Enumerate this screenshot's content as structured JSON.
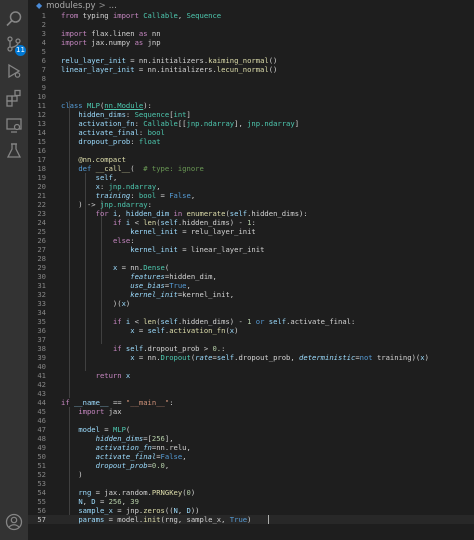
{
  "breadcrumb": {
    "file": "modules.py",
    "separator": ">",
    "tail": "..."
  },
  "activity_bar": {
    "icons": [
      {
        "name": "search-icon"
      },
      {
        "name": "source-control-icon",
        "badge": "11"
      },
      {
        "name": "run-debug-icon"
      },
      {
        "name": "extensions-icon"
      },
      {
        "name": "remote-explorer-icon"
      },
      {
        "name": "testing-icon"
      },
      {
        "name": "account-icon"
      }
    ]
  },
  "editor": {
    "current_line": 57,
    "lines": [
      {
        "n": "1",
        "t": [
          [
            "k",
            "from "
          ],
          [
            "w",
            "typing "
          ],
          [
            "k",
            "import "
          ],
          [
            "c",
            "Callable"
          ],
          [
            "w",
            ", "
          ],
          [
            "c",
            "Sequence"
          ]
        ]
      },
      {
        "n": "2",
        "t": []
      },
      {
        "n": "3",
        "t": [
          [
            "k",
            "import "
          ],
          [
            "w",
            "flax.linen "
          ],
          [
            "k",
            "as "
          ],
          [
            "w",
            "nn"
          ]
        ]
      },
      {
        "n": "4",
        "t": [
          [
            "k",
            "import "
          ],
          [
            "w",
            "jax.numpy "
          ],
          [
            "k",
            "as "
          ],
          [
            "w",
            "jnp"
          ]
        ]
      },
      {
        "n": "5",
        "t": []
      },
      {
        "n": "6",
        "t": [
          [
            "v",
            "relu_layer_init "
          ],
          [
            "w",
            "= nn.initializers."
          ],
          [
            "f",
            "kaiming_normal"
          ],
          [
            "w",
            "()"
          ]
        ]
      },
      {
        "n": "7",
        "t": [
          [
            "v",
            "linear_layer_init "
          ],
          [
            "w",
            "= nn.initializers."
          ],
          [
            "f",
            "lecun_normal"
          ],
          [
            "w",
            "()"
          ]
        ]
      },
      {
        "n": "8",
        "t": []
      },
      {
        "n": "9",
        "t": []
      },
      {
        "n": "10",
        "t": []
      },
      {
        "n": "11",
        "t": [
          [
            "kb",
            "class "
          ],
          [
            "c",
            "MLP"
          ],
          [
            "w",
            "("
          ],
          [
            "cg",
            "nn.Module"
          ],
          [
            "w",
            "):"
          ]
        ]
      },
      {
        "n": "12",
        "t": [
          [
            "w",
            "    "
          ],
          [
            "v",
            "hidden_dims"
          ],
          [
            "w",
            ": "
          ],
          [
            "c",
            "Sequence"
          ],
          [
            "w",
            "["
          ],
          [
            "c",
            "int"
          ],
          [
            "w",
            "]"
          ]
        ]
      },
      {
        "n": "13",
        "t": [
          [
            "w",
            "    "
          ],
          [
            "v",
            "activation_fn"
          ],
          [
            "w",
            ": "
          ],
          [
            "c",
            "Callable"
          ],
          [
            "w",
            "[["
          ],
          [
            "c",
            "jnp.ndarray"
          ],
          [
            "w",
            "], "
          ],
          [
            "c",
            "jnp.ndarray"
          ],
          [
            "w",
            "]"
          ]
        ]
      },
      {
        "n": "14",
        "t": [
          [
            "w",
            "    "
          ],
          [
            "v",
            "activate_final"
          ],
          [
            "w",
            ": "
          ],
          [
            "c",
            "bool"
          ]
        ]
      },
      {
        "n": "15",
        "t": [
          [
            "w",
            "    "
          ],
          [
            "v",
            "dropout_prob"
          ],
          [
            "w",
            ": "
          ],
          [
            "c",
            "float"
          ]
        ]
      },
      {
        "n": "16",
        "t": []
      },
      {
        "n": "17",
        "t": [
          [
            "w",
            "    "
          ],
          [
            "f",
            "@nn.compact"
          ]
        ]
      },
      {
        "n": "18",
        "t": [
          [
            "w",
            "    "
          ],
          [
            "kb",
            "def "
          ],
          [
            "f",
            "__call__"
          ],
          [
            "w",
            "(  "
          ],
          [
            "cm",
            "# type: ignore"
          ]
        ]
      },
      {
        "n": "19",
        "t": [
          [
            "w",
            "        "
          ],
          [
            "v",
            "self"
          ],
          [
            "w",
            ","
          ]
        ]
      },
      {
        "n": "20",
        "t": [
          [
            "w",
            "        "
          ],
          [
            "v",
            "x"
          ],
          [
            "w",
            ": "
          ],
          [
            "c",
            "jnp.ndarray"
          ],
          [
            "w",
            ","
          ]
        ]
      },
      {
        "n": "21",
        "t": [
          [
            "w",
            "        "
          ],
          [
            "i",
            "training"
          ],
          [
            "w",
            ": "
          ],
          [
            "c",
            "bool"
          ],
          [
            "w",
            " = "
          ],
          [
            "kb",
            "False"
          ],
          [
            "w",
            ","
          ]
        ]
      },
      {
        "n": "22",
        "t": [
          [
            "w",
            "    ) -> "
          ],
          [
            "c",
            "jnp.ndarray"
          ],
          [
            "w",
            ":"
          ]
        ]
      },
      {
        "n": "23",
        "t": [
          [
            "w",
            "        "
          ],
          [
            "k",
            "for "
          ],
          [
            "v",
            "i"
          ],
          [
            "w",
            ", "
          ],
          [
            "v",
            "hidden_dim "
          ],
          [
            "k",
            "in "
          ],
          [
            "f",
            "enumerate"
          ],
          [
            "w",
            "("
          ],
          [
            "v",
            "self"
          ],
          [
            "w",
            ".hidden_dims):"
          ]
        ]
      },
      {
        "n": "24",
        "t": [
          [
            "w",
            "            "
          ],
          [
            "k",
            "if "
          ],
          [
            "v",
            "i "
          ],
          [
            "w",
            "< "
          ],
          [
            "f",
            "len"
          ],
          [
            "w",
            "("
          ],
          [
            "v",
            "self"
          ],
          [
            "w",
            ".hidden_dims) - "
          ],
          [
            "n",
            "1"
          ],
          [
            "w",
            ":"
          ]
        ]
      },
      {
        "n": "25",
        "t": [
          [
            "w",
            "                "
          ],
          [
            "v",
            "kernel_init "
          ],
          [
            "w",
            "= relu_layer_init"
          ]
        ]
      },
      {
        "n": "26",
        "t": [
          [
            "w",
            "            "
          ],
          [
            "k",
            "else"
          ],
          [
            "w",
            ":"
          ]
        ]
      },
      {
        "n": "27",
        "t": [
          [
            "w",
            "                "
          ],
          [
            "v",
            "kernel_init "
          ],
          [
            "w",
            "= linear_layer_init"
          ]
        ]
      },
      {
        "n": "28",
        "t": []
      },
      {
        "n": "29",
        "t": [
          [
            "w",
            "            "
          ],
          [
            "v",
            "x "
          ],
          [
            "w",
            "= nn."
          ],
          [
            "c",
            "Dense"
          ],
          [
            "w",
            "("
          ]
        ]
      },
      {
        "n": "30",
        "t": [
          [
            "w",
            "                "
          ],
          [
            "i",
            "features"
          ],
          [
            "w",
            "=hidden_dim,"
          ]
        ]
      },
      {
        "n": "31",
        "t": [
          [
            "w",
            "                "
          ],
          [
            "i",
            "use_bias"
          ],
          [
            "w",
            "="
          ],
          [
            "kb",
            "True"
          ],
          [
            "w",
            ","
          ]
        ]
      },
      {
        "n": "32",
        "t": [
          [
            "w",
            "                "
          ],
          [
            "i",
            "kernel_init"
          ],
          [
            "w",
            "=kernel_init,"
          ]
        ]
      },
      {
        "n": "33",
        "t": [
          [
            "w",
            "            )("
          ],
          [
            "v",
            "x"
          ],
          [
            "w",
            ")"
          ]
        ]
      },
      {
        "n": "34",
        "t": []
      },
      {
        "n": "35",
        "t": [
          [
            "w",
            "            "
          ],
          [
            "k",
            "if "
          ],
          [
            "v",
            "i "
          ],
          [
            "w",
            "< "
          ],
          [
            "f",
            "len"
          ],
          [
            "w",
            "("
          ],
          [
            "v",
            "self"
          ],
          [
            "w",
            ".hidden_dims) - "
          ],
          [
            "n",
            "1 "
          ],
          [
            "kb",
            "or "
          ],
          [
            "v",
            "self"
          ],
          [
            "w",
            ".activate_final:"
          ]
        ]
      },
      {
        "n": "36",
        "t": [
          [
            "w",
            "                "
          ],
          [
            "v",
            "x "
          ],
          [
            "w",
            "= "
          ],
          [
            "v",
            "self"
          ],
          [
            "w",
            "."
          ],
          [
            "f",
            "activation_fn"
          ],
          [
            "w",
            "("
          ],
          [
            "v",
            "x"
          ],
          [
            "w",
            ")"
          ]
        ]
      },
      {
        "n": "37",
        "t": []
      },
      {
        "n": "38",
        "t": [
          [
            "w",
            "            "
          ],
          [
            "k",
            "if "
          ],
          [
            "v",
            "self"
          ],
          [
            "w",
            ".dropout_prob > "
          ],
          [
            "n",
            "0."
          ],
          [
            "w",
            ":"
          ]
        ]
      },
      {
        "n": "39",
        "t": [
          [
            "w",
            "                "
          ],
          [
            "v",
            "x "
          ],
          [
            "w",
            "= nn."
          ],
          [
            "c",
            "Dropout"
          ],
          [
            "w",
            "("
          ],
          [
            "i",
            "rate"
          ],
          [
            "w",
            "="
          ],
          [
            "v",
            "self"
          ],
          [
            "w",
            ".dropout_prob, "
          ],
          [
            "i",
            "deterministic"
          ],
          [
            "w",
            "="
          ],
          [
            "kb",
            "not "
          ],
          [
            "w",
            "training)("
          ],
          [
            "v",
            "x"
          ],
          [
            "w",
            ")"
          ]
        ]
      },
      {
        "n": "40",
        "t": []
      },
      {
        "n": "41",
        "t": [
          [
            "w",
            "        "
          ],
          [
            "k",
            "return "
          ],
          [
            "v",
            "x"
          ]
        ]
      },
      {
        "n": "42",
        "t": []
      },
      {
        "n": "43",
        "t": []
      },
      {
        "n": "44",
        "t": [
          [
            "k",
            "if "
          ],
          [
            "v",
            "__name__ "
          ],
          [
            "w",
            "== "
          ],
          [
            "s",
            "\"__main__\""
          ],
          [
            "w",
            ":"
          ]
        ]
      },
      {
        "n": "45",
        "t": [
          [
            "w",
            "    "
          ],
          [
            "k",
            "import "
          ],
          [
            "w",
            "jax"
          ]
        ]
      },
      {
        "n": "46",
        "t": []
      },
      {
        "n": "47",
        "t": [
          [
            "w",
            "    "
          ],
          [
            "v",
            "model "
          ],
          [
            "w",
            "= "
          ],
          [
            "c",
            "MLP"
          ],
          [
            "w",
            "("
          ]
        ]
      },
      {
        "n": "48",
        "t": [
          [
            "w",
            "        "
          ],
          [
            "i",
            "hidden_dims"
          ],
          [
            "w",
            "=["
          ],
          [
            "n",
            "256"
          ],
          [
            "w",
            "],"
          ]
        ]
      },
      {
        "n": "49",
        "t": [
          [
            "w",
            "        "
          ],
          [
            "i",
            "activation_fn"
          ],
          [
            "w",
            "=nn.relu,"
          ]
        ]
      },
      {
        "n": "50",
        "t": [
          [
            "w",
            "        "
          ],
          [
            "i",
            "activate_final"
          ],
          [
            "w",
            "="
          ],
          [
            "kb",
            "False"
          ],
          [
            "w",
            ","
          ]
        ]
      },
      {
        "n": "51",
        "t": [
          [
            "w",
            "        "
          ],
          [
            "i",
            "dropout_prob"
          ],
          [
            "w",
            "="
          ],
          [
            "n",
            "0.0"
          ],
          [
            "w",
            ","
          ]
        ]
      },
      {
        "n": "52",
        "t": [
          [
            "w",
            "    )"
          ]
        ]
      },
      {
        "n": "53",
        "t": []
      },
      {
        "n": "54",
        "t": [
          [
            "w",
            "    "
          ],
          [
            "v",
            "rng "
          ],
          [
            "w",
            "= jax.random."
          ],
          [
            "f",
            "PRNGKey"
          ],
          [
            "w",
            "("
          ],
          [
            "n",
            "0"
          ],
          [
            "w",
            ")"
          ]
        ]
      },
      {
        "n": "55",
        "t": [
          [
            "w",
            "    "
          ],
          [
            "v",
            "N"
          ],
          [
            "w",
            ", "
          ],
          [
            "v",
            "D "
          ],
          [
            "w",
            "= "
          ],
          [
            "n",
            "256"
          ],
          [
            "w",
            ", "
          ],
          [
            "n",
            "39"
          ]
        ]
      },
      {
        "n": "56",
        "t": [
          [
            "w",
            "    "
          ],
          [
            "v",
            "sample_x "
          ],
          [
            "w",
            "= jnp."
          ],
          [
            "f",
            "zeros"
          ],
          [
            "w",
            "(("
          ],
          [
            "v",
            "N"
          ],
          [
            "w",
            ", "
          ],
          [
            "v",
            "D"
          ],
          [
            "w",
            "))"
          ]
        ]
      },
      {
        "n": "57",
        "t": [
          [
            "w",
            "    "
          ],
          [
            "v",
            "params "
          ],
          [
            "w",
            "= model."
          ],
          [
            "f",
            "init"
          ],
          [
            "w",
            "(rng, sample_x, "
          ],
          [
            "kb",
            "True"
          ],
          [
            "w",
            ")"
          ]
        ]
      }
    ]
  }
}
